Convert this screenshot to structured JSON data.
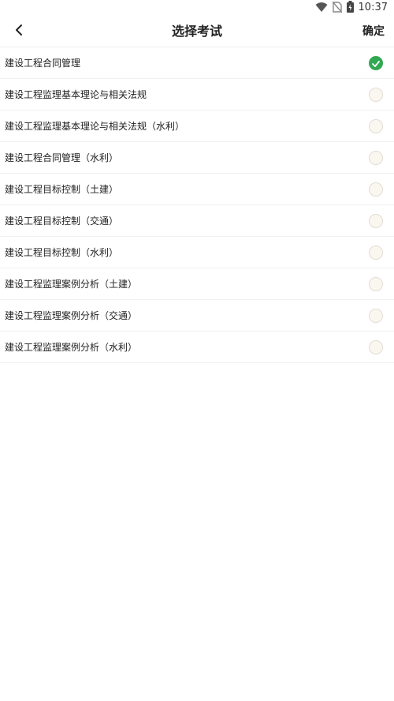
{
  "status_bar": {
    "time": "10:37",
    "icons": [
      "wifi-icon",
      "no-sim-icon",
      "battery-charging-icon"
    ]
  },
  "header": {
    "back_icon": "chevron-left-icon",
    "title": "选择考试",
    "confirm_label": "确定"
  },
  "colors": {
    "accent_checked": "#32a852",
    "radio_unchecked_fill": "#faf7f0",
    "divider": "#f0f0f0"
  },
  "exams": {
    "items": [
      {
        "label": "建设工程合同管理",
        "selected": true
      },
      {
        "label": "建设工程监理基本理论与相关法规",
        "selected": false
      },
      {
        "label": "建设工程监理基本理论与相关法规（水利）",
        "selected": false
      },
      {
        "label": "建设工程合同管理（水利）",
        "selected": false
      },
      {
        "label": "建设工程目标控制（土建）",
        "selected": false
      },
      {
        "label": "建设工程目标控制（交通）",
        "selected": false
      },
      {
        "label": "建设工程目标控制（水利）",
        "selected": false
      },
      {
        "label": "建设工程监理案例分析（土建）",
        "selected": false
      },
      {
        "label": "建设工程监理案例分析（交通）",
        "selected": false
      },
      {
        "label": "建设工程监理案例分析（水利）",
        "selected": false
      }
    ]
  }
}
